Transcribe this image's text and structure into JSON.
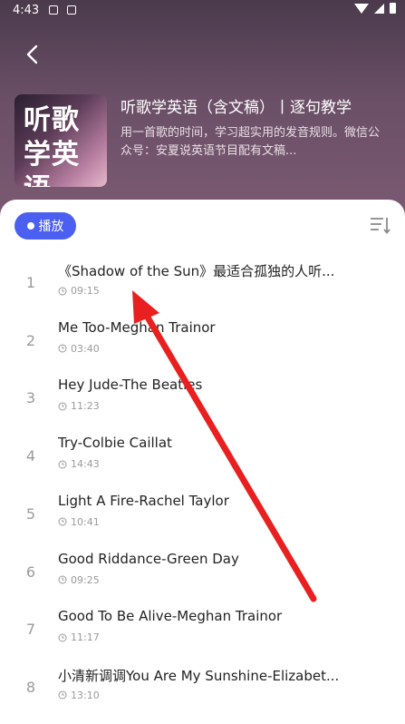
{
  "status_bar": {
    "time": "4:43"
  },
  "album": {
    "cover_text_line1": "听歌",
    "cover_text_line2": "学英语",
    "title": "听歌学英语（含文稿）丨逐句教学",
    "description": "用一首歌的时间，学习超实用的发音规则。微信公众号：安夏说英语节目配有文稿..."
  },
  "controls": {
    "play_label": "播放"
  },
  "tracks": [
    {
      "index": "1",
      "title": "《Shadow of the Sun》最适合孤独的人听...",
      "duration": "09:15"
    },
    {
      "index": "2",
      "title": "Me Too-Meghan Trainor",
      "duration": "03:40"
    },
    {
      "index": "3",
      "title": "Hey Jude-The Beatles",
      "duration": "11:23"
    },
    {
      "index": "4",
      "title": "Try-Colbie Caillat",
      "duration": "14:43"
    },
    {
      "index": "5",
      "title": "Light A Fire-Rachel Taylor",
      "duration": "10:41"
    },
    {
      "index": "6",
      "title": "Good Riddance-Green Day",
      "duration": "09:25"
    },
    {
      "index": "7",
      "title": "Good To Be Alive-Meghan Trainor",
      "duration": "11:17"
    },
    {
      "index": "8",
      "title": "小清新调调You Are My Sunshine-Elizabet...",
      "duration": "13:10"
    }
  ],
  "icons": {
    "back": "chevron-left-icon",
    "sort": "sort-icon",
    "clock": "clock-icon",
    "play": "play-icon"
  },
  "colors": {
    "accent": "#4b5ff0",
    "annotation_arrow": "#e8201f"
  }
}
